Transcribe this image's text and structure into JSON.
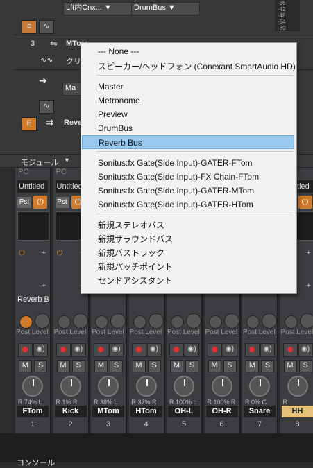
{
  "tracks": {
    "io_input": "Lft内Cnx...",
    "io_output": "DrumBus",
    "track3_number": "3",
    "track3_name": "MTom",
    "track3_clip": "クリ",
    "track5_chip": "Ma",
    "reverb_name": "Reve",
    "e_label": "E",
    "meter_values": [
      "-36",
      "-42",
      "-48",
      "-54",
      "-60"
    ]
  },
  "module_label": "モジュール",
  "menu": {
    "items": [
      "--- None ---",
      "スピーカー/ヘッドフォン (Conexant SmartAudio HD)",
      "Master",
      "Metronome",
      "Preview",
      "DrumBus",
      "Reverb Bus",
      "Sonitus:fx Gate(Side Input)-GATER-FTom",
      "Sonitus:fx Gate(Side Input)-FX Chain-FTom",
      "Sonitus:fx Gate(Side Input)-GATER-MTom",
      "Sonitus:fx Gate(Side Input)-GATER-HTom",
      "新規ステレオバス",
      "新規サラウンドバス",
      "新規バストラック",
      "新規パッチポイント",
      "センドアシスタント"
    ],
    "selected": "Reverb Bus"
  },
  "strips": [
    {
      "name": "FTom",
      "number": "1",
      "pan": "R 74% L",
      "send": "Reverb B",
      "pc": "PC",
      "untitled": "Untitled",
      "pst": "Pst"
    },
    {
      "name": "Kick",
      "number": "2",
      "pan": "R 1% R",
      "pc": "PC",
      "untitled": "Untitled",
      "pst": "Pst"
    },
    {
      "name": "MTom",
      "number": "3",
      "pan": "R 38% L"
    },
    {
      "name": "HTom",
      "number": "4",
      "pan": "R 37% R"
    },
    {
      "name": "OH-L",
      "number": "5",
      "pan": "R 100% L"
    },
    {
      "name": "OH-R",
      "number": "6",
      "pan": "R 100% R"
    },
    {
      "name": "Snare",
      "number": "7",
      "pan": "R 0% C"
    },
    {
      "name": "HH",
      "number": "8",
      "pan": "R",
      "untitled": "Untitled"
    }
  ],
  "labels": {
    "post_level": "Post Level",
    "m": "M",
    "s": "S"
  },
  "bottom_label": "コンソール"
}
